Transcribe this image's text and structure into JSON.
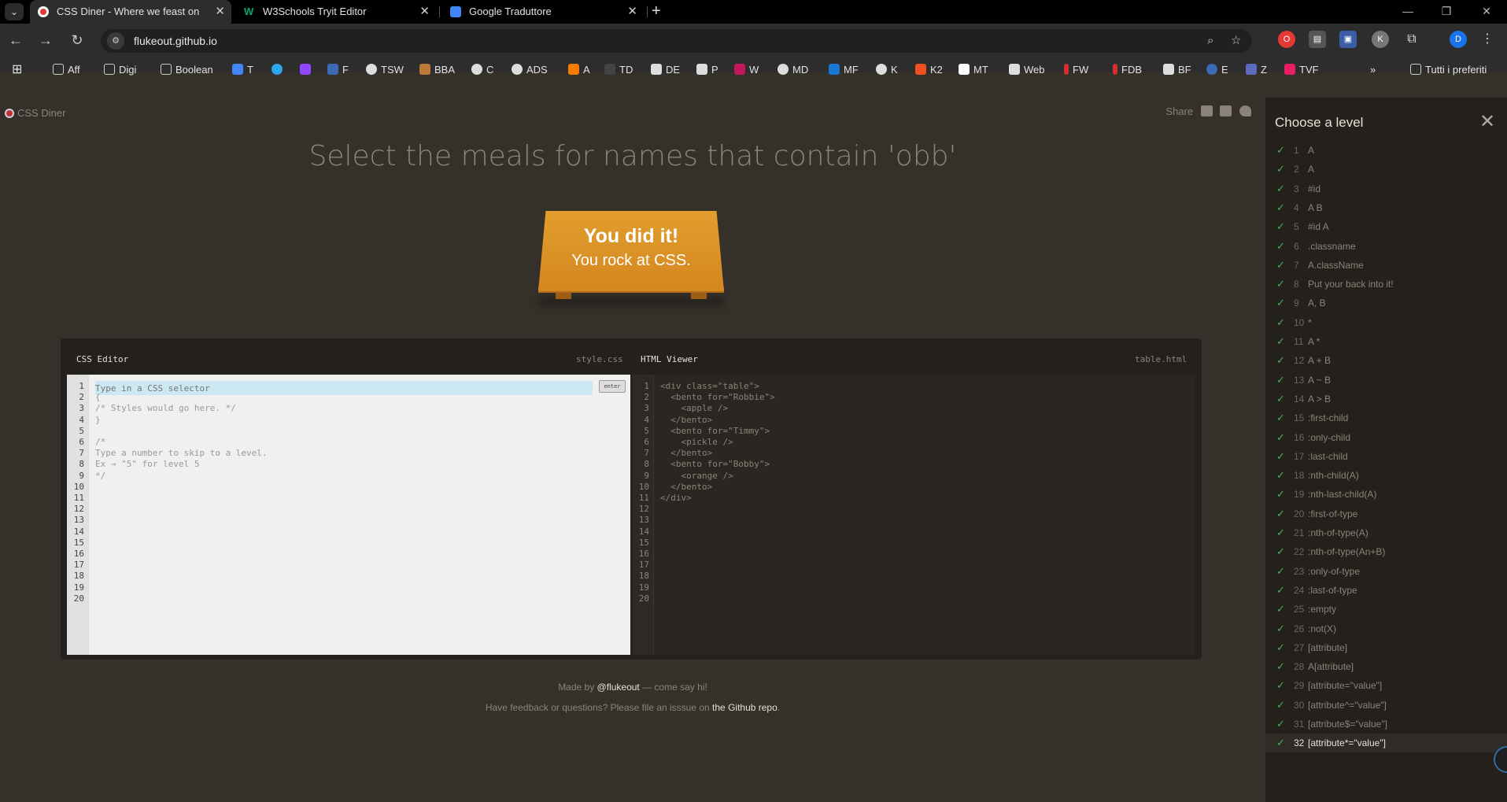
{
  "browser": {
    "tabs": [
      {
        "title": "CSS Diner - Where we feast on",
        "icon": "css-diner-favicon",
        "active": true
      },
      {
        "title": "W3Schools Tryit Editor",
        "icon": "w3schools-favicon",
        "active": false
      },
      {
        "title": "Google Traduttore",
        "icon": "google-translate-favicon",
        "active": false
      }
    ],
    "url": "flukeout.github.io",
    "profile_initial": "D",
    "ext_initial": "K",
    "bookmarks": [
      "Aff",
      "Digi",
      "Boolean",
      "T",
      "",
      "",
      "F",
      "TSW",
      "BBA",
      "C",
      "ADS",
      "A",
      "TD",
      "DE",
      "P",
      "W",
      "MD",
      "MF",
      "K",
      "K2",
      "MT",
      "Web",
      "FW",
      "FDB",
      "BF",
      "E",
      "Z",
      "TVF"
    ],
    "all_bookmarks": "Tutti i preferiti",
    "more": "»"
  },
  "page": {
    "logo": "CSS Diner",
    "share": "Share",
    "order": "Select the meals for names that contain 'obb'",
    "win_line1": "You did it!",
    "win_line2": "You rock at CSS."
  },
  "css_editor": {
    "title": "CSS Editor",
    "file": "style.css",
    "placeholder": "Type in a CSS selector",
    "enter": "enter",
    "lines": [
      "{",
      "/* Styles would go here. */",
      "}",
      "",
      "/*",
      "Type a number to skip to a level.",
      "Ex → \"5\" for level 5",
      "*/"
    ]
  },
  "html_viewer": {
    "title": "HTML Viewer",
    "file": "table.html",
    "lines": [
      "<div class=\"table\">",
      "  <bento for=\"Robbie\">",
      "    <apple />",
      "  </bento>",
      "  <bento for=\"Timmy\">",
      "    <pickle />",
      "  </bento>",
      "  <bento for=\"Bobby\">",
      "    <orange />",
      "  </bento>",
      "</div>"
    ]
  },
  "line_numbers": [
    "1",
    "2",
    "3",
    "4",
    "5",
    "6",
    "7",
    "8",
    "9",
    "10",
    "11",
    "12",
    "13",
    "14",
    "15",
    "16",
    "17",
    "18",
    "19",
    "20"
  ],
  "footer": {
    "made_by_pre": "Made by ",
    "made_by_link": "@flukeout",
    "made_by_post": " — come say hi!",
    "feedback_pre": "Have feedback or questions? Please file an isssue on ",
    "feedback_link": "the Github repo",
    "feedback_post": "."
  },
  "sidebar": {
    "title": "Choose a level",
    "levels": [
      {
        "num": "1",
        "name": "A"
      },
      {
        "num": "2",
        "name": "A"
      },
      {
        "num": "3",
        "name": "#id"
      },
      {
        "num": "4",
        "name": "A B"
      },
      {
        "num": "5",
        "name": "#id A"
      },
      {
        "num": "6",
        "name": ".classname"
      },
      {
        "num": "7",
        "name": "A.className"
      },
      {
        "num": "8",
        "name": "Put your back into it!"
      },
      {
        "num": "9",
        "name": "A, B"
      },
      {
        "num": "10",
        "name": "*"
      },
      {
        "num": "11",
        "name": "A *"
      },
      {
        "num": "12",
        "name": "A + B"
      },
      {
        "num": "13",
        "name": "A ~ B"
      },
      {
        "num": "14",
        "name": "A > B"
      },
      {
        "num": "15",
        "name": ":first-child"
      },
      {
        "num": "16",
        "name": ":only-child"
      },
      {
        "num": "17",
        "name": ":last-child"
      },
      {
        "num": "18",
        "name": ":nth-child(A)"
      },
      {
        "num": "19",
        "name": ":nth-last-child(A)"
      },
      {
        "num": "20",
        "name": ":first-of-type"
      },
      {
        "num": "21",
        "name": ":nth-of-type(A)"
      },
      {
        "num": "22",
        "name": ":nth-of-type(An+B)"
      },
      {
        "num": "23",
        "name": ":only-of-type"
      },
      {
        "num": "24",
        "name": ":last-of-type"
      },
      {
        "num": "25",
        "name": ":empty"
      },
      {
        "num": "26",
        "name": ":not(X)"
      },
      {
        "num": "27",
        "name": "[attribute]"
      },
      {
        "num": "28",
        "name": "A[attribute]"
      },
      {
        "num": "29",
        "name": "[attribute=\"value\"]"
      },
      {
        "num": "30",
        "name": "[attribute^=\"value\"]"
      },
      {
        "num": "31",
        "name": "[attribute$=\"value\"]"
      },
      {
        "num": "32",
        "name": "[attribute*=\"value\"]"
      }
    ],
    "current_level": "32"
  },
  "colors": {
    "accent": "#d48720",
    "check": "#4caf50",
    "bg": "#35312a"
  }
}
